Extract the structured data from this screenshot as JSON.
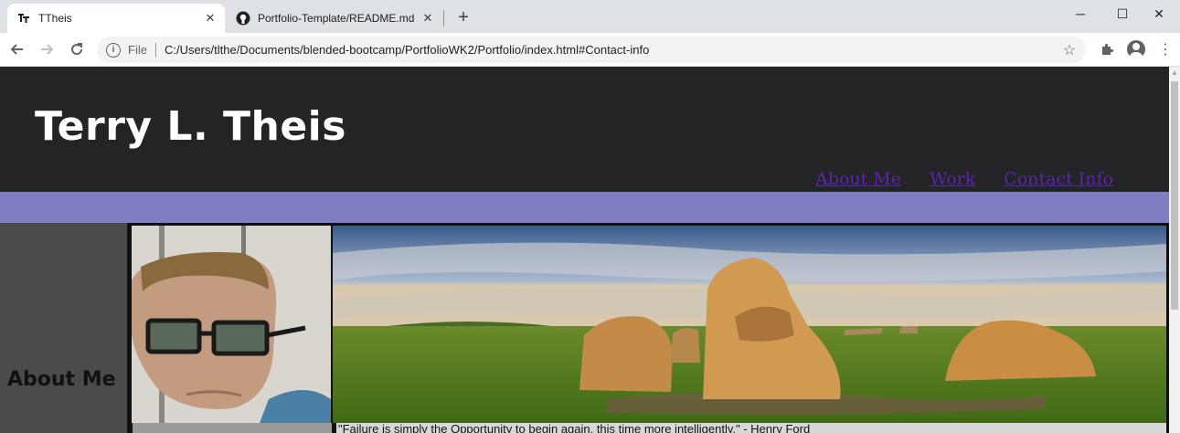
{
  "browser": {
    "tabs": [
      {
        "title": "TTheis",
        "favicon": "tt-logo-icon",
        "active": true
      },
      {
        "title": "Portfolio-Template/README.md",
        "favicon": "github-icon",
        "active": false
      }
    ],
    "new_tab_label": "+",
    "address": {
      "scheme_label": "File",
      "url": "C:/Users/tlthe/Documents/blended-bootcamp/PortfolioWK2/Portfolio/index.html#Contact-info"
    },
    "window_controls": {
      "minimize": "─",
      "maximize": "☐",
      "close": "✕"
    }
  },
  "site": {
    "title": "Terry L. Theis",
    "nav": [
      "About Me",
      "Work",
      "Contact Info"
    ],
    "section_heading": "About Me",
    "quote_fragment": "\"Failure is simply the Opportunity to begin again, this time more intelligently.\" - Henry Ford"
  },
  "colors": {
    "header_bg": "#232425",
    "band": "#7f7fc1",
    "nav_link": "#5a27a8",
    "left_col": "#4a4a4a"
  }
}
